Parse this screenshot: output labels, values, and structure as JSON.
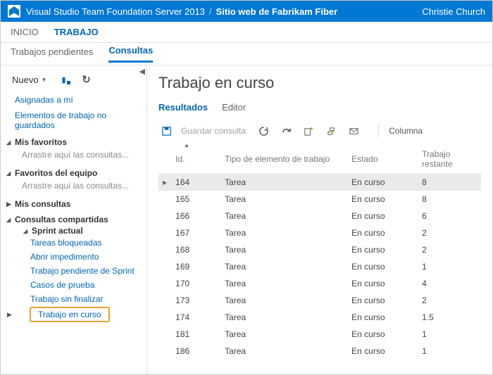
{
  "header": {
    "product": "Visual Studio Team Foundation Server 2013",
    "site": "Sitio web de Fabrikam Fiber",
    "user": "Christie Church"
  },
  "nav1": {
    "items": [
      "INICIO",
      "TRABAJO"
    ],
    "active": 1
  },
  "nav2": {
    "items": [
      "Trabajos pendientes",
      "Consultas"
    ],
    "active": 1
  },
  "side": {
    "new": "Nuevo",
    "links": [
      "Asignadas a mí",
      "Elementos de trabajo no guardados"
    ],
    "fav_mine": {
      "title": "Mis favoritos",
      "hint": "Arrastre aquí las consultas..."
    },
    "fav_team": {
      "title": "Favoritos del equipo",
      "hint": "Arrastre aquí las consultas..."
    },
    "my_q": "Mis consultas",
    "shared": {
      "title": "Consultas compartidas",
      "sprint": "Sprint actual",
      "items": [
        "Tareas bloqueadas",
        "Abrir impedimento",
        "Trabajo pendiente de Sprint",
        "Casos de prueba",
        "Trabajo sin finalizar"
      ],
      "selected": "Trabajo en curso"
    }
  },
  "main": {
    "title": "Trabajo en curso",
    "tabs": [
      "Resultados",
      "Editor"
    ],
    "toolbar": {
      "save": "Guardar consulta",
      "column": "Columna"
    },
    "columns": [
      "Id.",
      "Tipo de elemento de trabajo",
      "Estado",
      "Trabajo restante"
    ],
    "rows": [
      {
        "id": "164",
        "type": "Tarea",
        "state": "En curso",
        "rem": "8",
        "sel": true
      },
      {
        "id": "165",
        "type": "Tarea",
        "state": "En curso",
        "rem": "8"
      },
      {
        "id": "166",
        "type": "Tarea",
        "state": "En curso",
        "rem": "6"
      },
      {
        "id": "167",
        "type": "Tarea",
        "state": "En curso",
        "rem": "2"
      },
      {
        "id": "168",
        "type": "Tarea",
        "state": "En curso",
        "rem": "2"
      },
      {
        "id": "169",
        "type": "Tarea",
        "state": "En curso",
        "rem": "1"
      },
      {
        "id": "170",
        "type": "Tarea",
        "state": "En curso",
        "rem": "4"
      },
      {
        "id": "173",
        "type": "Tarea",
        "state": "En curso",
        "rem": "2"
      },
      {
        "id": "174",
        "type": "Tarea",
        "state": "En curso",
        "rem": "1.5"
      },
      {
        "id": "181",
        "type": "Tarea",
        "state": "En curso",
        "rem": "1"
      },
      {
        "id": "186",
        "type": "Tarea",
        "state": "En curso",
        "rem": "1"
      }
    ]
  }
}
